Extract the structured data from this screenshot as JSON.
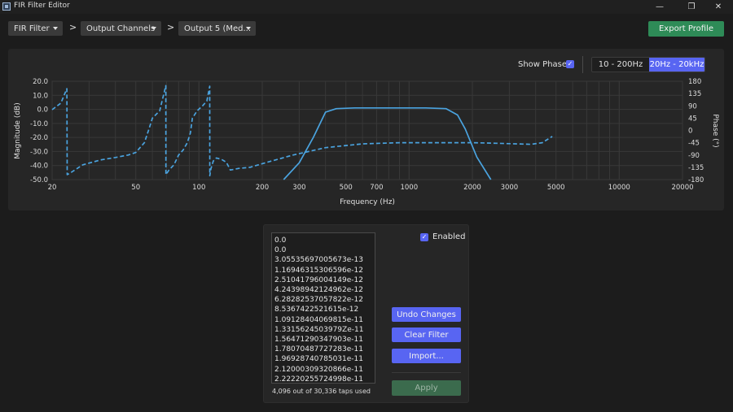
{
  "window": {
    "title": "FIR Filter Editor"
  },
  "breadcrumb": {
    "items": [
      {
        "label": "FIR Filter"
      },
      {
        "label": "Output Channels"
      },
      {
        "label": "Output 5 (Med..."
      }
    ],
    "separator": ">"
  },
  "toolbar": {
    "export_label": "Export Profile"
  },
  "chart_controls": {
    "show_phase_label": "Show Phase",
    "show_phase_checked": true,
    "range_options": [
      "10 - 200Hz",
      "20Hz - 20kHz"
    ],
    "active_range": "20Hz - 20kHz"
  },
  "chart_data": {
    "type": "line",
    "xlabel": "Frequency (Hz)",
    "ylabel": "Magnitude (dB)",
    "y2label": "Phase (°)",
    "xscale": "log",
    "xlim": [
      20,
      20000
    ],
    "ylim": [
      -50,
      20
    ],
    "y2lim": [
      -180,
      180
    ],
    "x_ticks": [
      "20",
      "50",
      "100",
      "200",
      "300",
      "500",
      "700",
      "1000",
      "2000",
      "3000",
      "5000",
      "10000",
      "20000"
    ],
    "y_ticks": [
      "20.0",
      "10.0",
      "0.0",
      "-10.0",
      "-20.0",
      "-30.0",
      "-40.0",
      "-50.0"
    ],
    "y2_ticks": [
      "180",
      "135",
      "90",
      "45",
      "0",
      "-45",
      "-90",
      "-135",
      "-180"
    ],
    "grid": true,
    "series": [
      {
        "style": "solid",
        "axis": "left",
        "color": "#4aa3df",
        "x": [
          253,
          300,
          350,
          400,
          450,
          550,
          800,
          1200,
          1500,
          1700,
          1850,
          2100,
          2450
        ],
        "y": [
          -50,
          -38,
          -20,
          -2,
          0.5,
          1,
          1,
          1,
          0.5,
          -4,
          -14,
          -34,
          -50
        ]
      },
      {
        "style": "dashed",
        "axis": "right",
        "color": "#4aa3df",
        "x": [
          20,
          22,
          23.5,
          23.6,
          24.5,
          28,
          34,
          40,
          46,
          50,
          55,
          58,
          60,
          65,
          69.5,
          69.6,
          72,
          76,
          80,
          84,
          88,
          91,
          93,
          98,
          104,
          109,
          112.5,
          112.6,
          114,
          117,
          121,
          128,
          135,
          141,
          148,
          155,
          175,
          210,
          280,
          400,
          600,
          900,
          1400,
          2000,
          2600,
          3200,
          3800,
          4300,
          4800
        ],
        "y": [
          76,
          100,
          153,
          -162,
          -155,
          -126,
          -108,
          -99,
          -90,
          -81,
          -45,
          9,
          45,
          72,
          164,
          -162,
          -145,
          -126,
          -90,
          -72,
          -45,
          -9,
          45,
          72,
          90,
          108,
          162,
          -166,
          -140,
          -112,
          -101,
          -106,
          -117,
          -145,
          -142,
          -139,
          -135,
          -117,
          -90,
          -63,
          -49,
          -45,
          -45,
          -45,
          -47,
          -49,
          -51,
          -45,
          -22
        ]
      }
    ]
  },
  "editor": {
    "taps": [
      "0.0",
      "0.0",
      "3.05535697005673e-13",
      "1.16946315306596e-12",
      "2.51041796004149e-12",
      "4.24398942124962e-12",
      "6.28282537057822e-12",
      "8.5367422521615e-12",
      "1.09128404069815e-11",
      "1.3315624503979Ze-11",
      "1.56471290347903e-11",
      "1.78070487727283e-11",
      "1.96928740785031e-11",
      "2.12000309320866e-11",
      "2.22220255724998e-11"
    ],
    "taps_used": "4,096 out of 30,336 taps used",
    "enabled_label": "Enabled",
    "enabled_checked": true,
    "undo_label": "Undo Changes",
    "clear_label": "Clear Filter",
    "import_label": "Import...",
    "apply_label": "Apply"
  }
}
